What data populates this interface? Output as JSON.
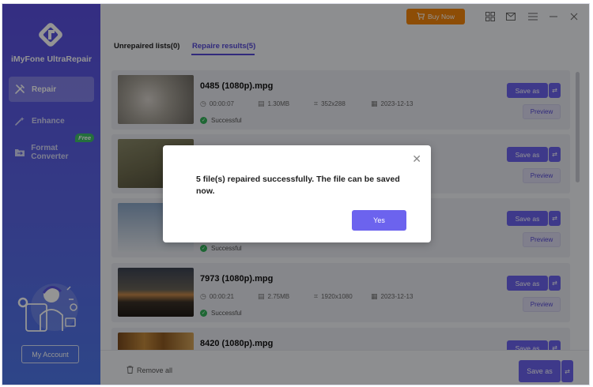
{
  "app": {
    "name": "iMyFone UltraRepair"
  },
  "sidebar": {
    "items": [
      {
        "label": "Repair",
        "icon": "tools-icon",
        "active": true
      },
      {
        "label": "Enhance",
        "icon": "magic-wand-icon",
        "active": false
      },
      {
        "label": "Format Converter",
        "icon": "folder-convert-icon",
        "active": false,
        "badge": "Free"
      }
    ],
    "account_label": "My Account"
  },
  "topbar": {
    "buy_label": "Buy Now"
  },
  "tabs": [
    {
      "label": "Unrepaired lists(0)",
      "active": false
    },
    {
      "label": "Repaire results(5)",
      "active": true
    }
  ],
  "files": [
    {
      "name": "0485 (1080p).mpg",
      "duration": "00:00:07",
      "size": "1.30MB",
      "resolution": "352x288",
      "date": "2023-12-13",
      "status": "Successful"
    },
    {
      "name": "",
      "duration": "",
      "size": "",
      "resolution": "",
      "date": "",
      "status": ""
    },
    {
      "name": "",
      "duration": "",
      "size": "",
      "resolution": "",
      "date": "",
      "status": "Successful"
    },
    {
      "name": "7973 (1080p).mpg",
      "duration": "00:00:21",
      "size": "2.75MB",
      "resolution": "1920x1080",
      "date": "2023-12-13",
      "status": "Successful"
    },
    {
      "name": "8420 (1080p).mpg",
      "duration": "",
      "size": "",
      "resolution": "",
      "date": "",
      "status": ""
    }
  ],
  "row_actions": {
    "save_label": "Save as",
    "preview_label": "Preview"
  },
  "bottombar": {
    "remove_all_label": "Remove all",
    "save_label": "Save as"
  },
  "dialog": {
    "message": "5 file(s) repaired successfully. The file can be saved now.",
    "yes_label": "Yes"
  },
  "colors": {
    "accent": "#6c63ee",
    "buy": "#f3850c",
    "success": "#34b25b"
  }
}
